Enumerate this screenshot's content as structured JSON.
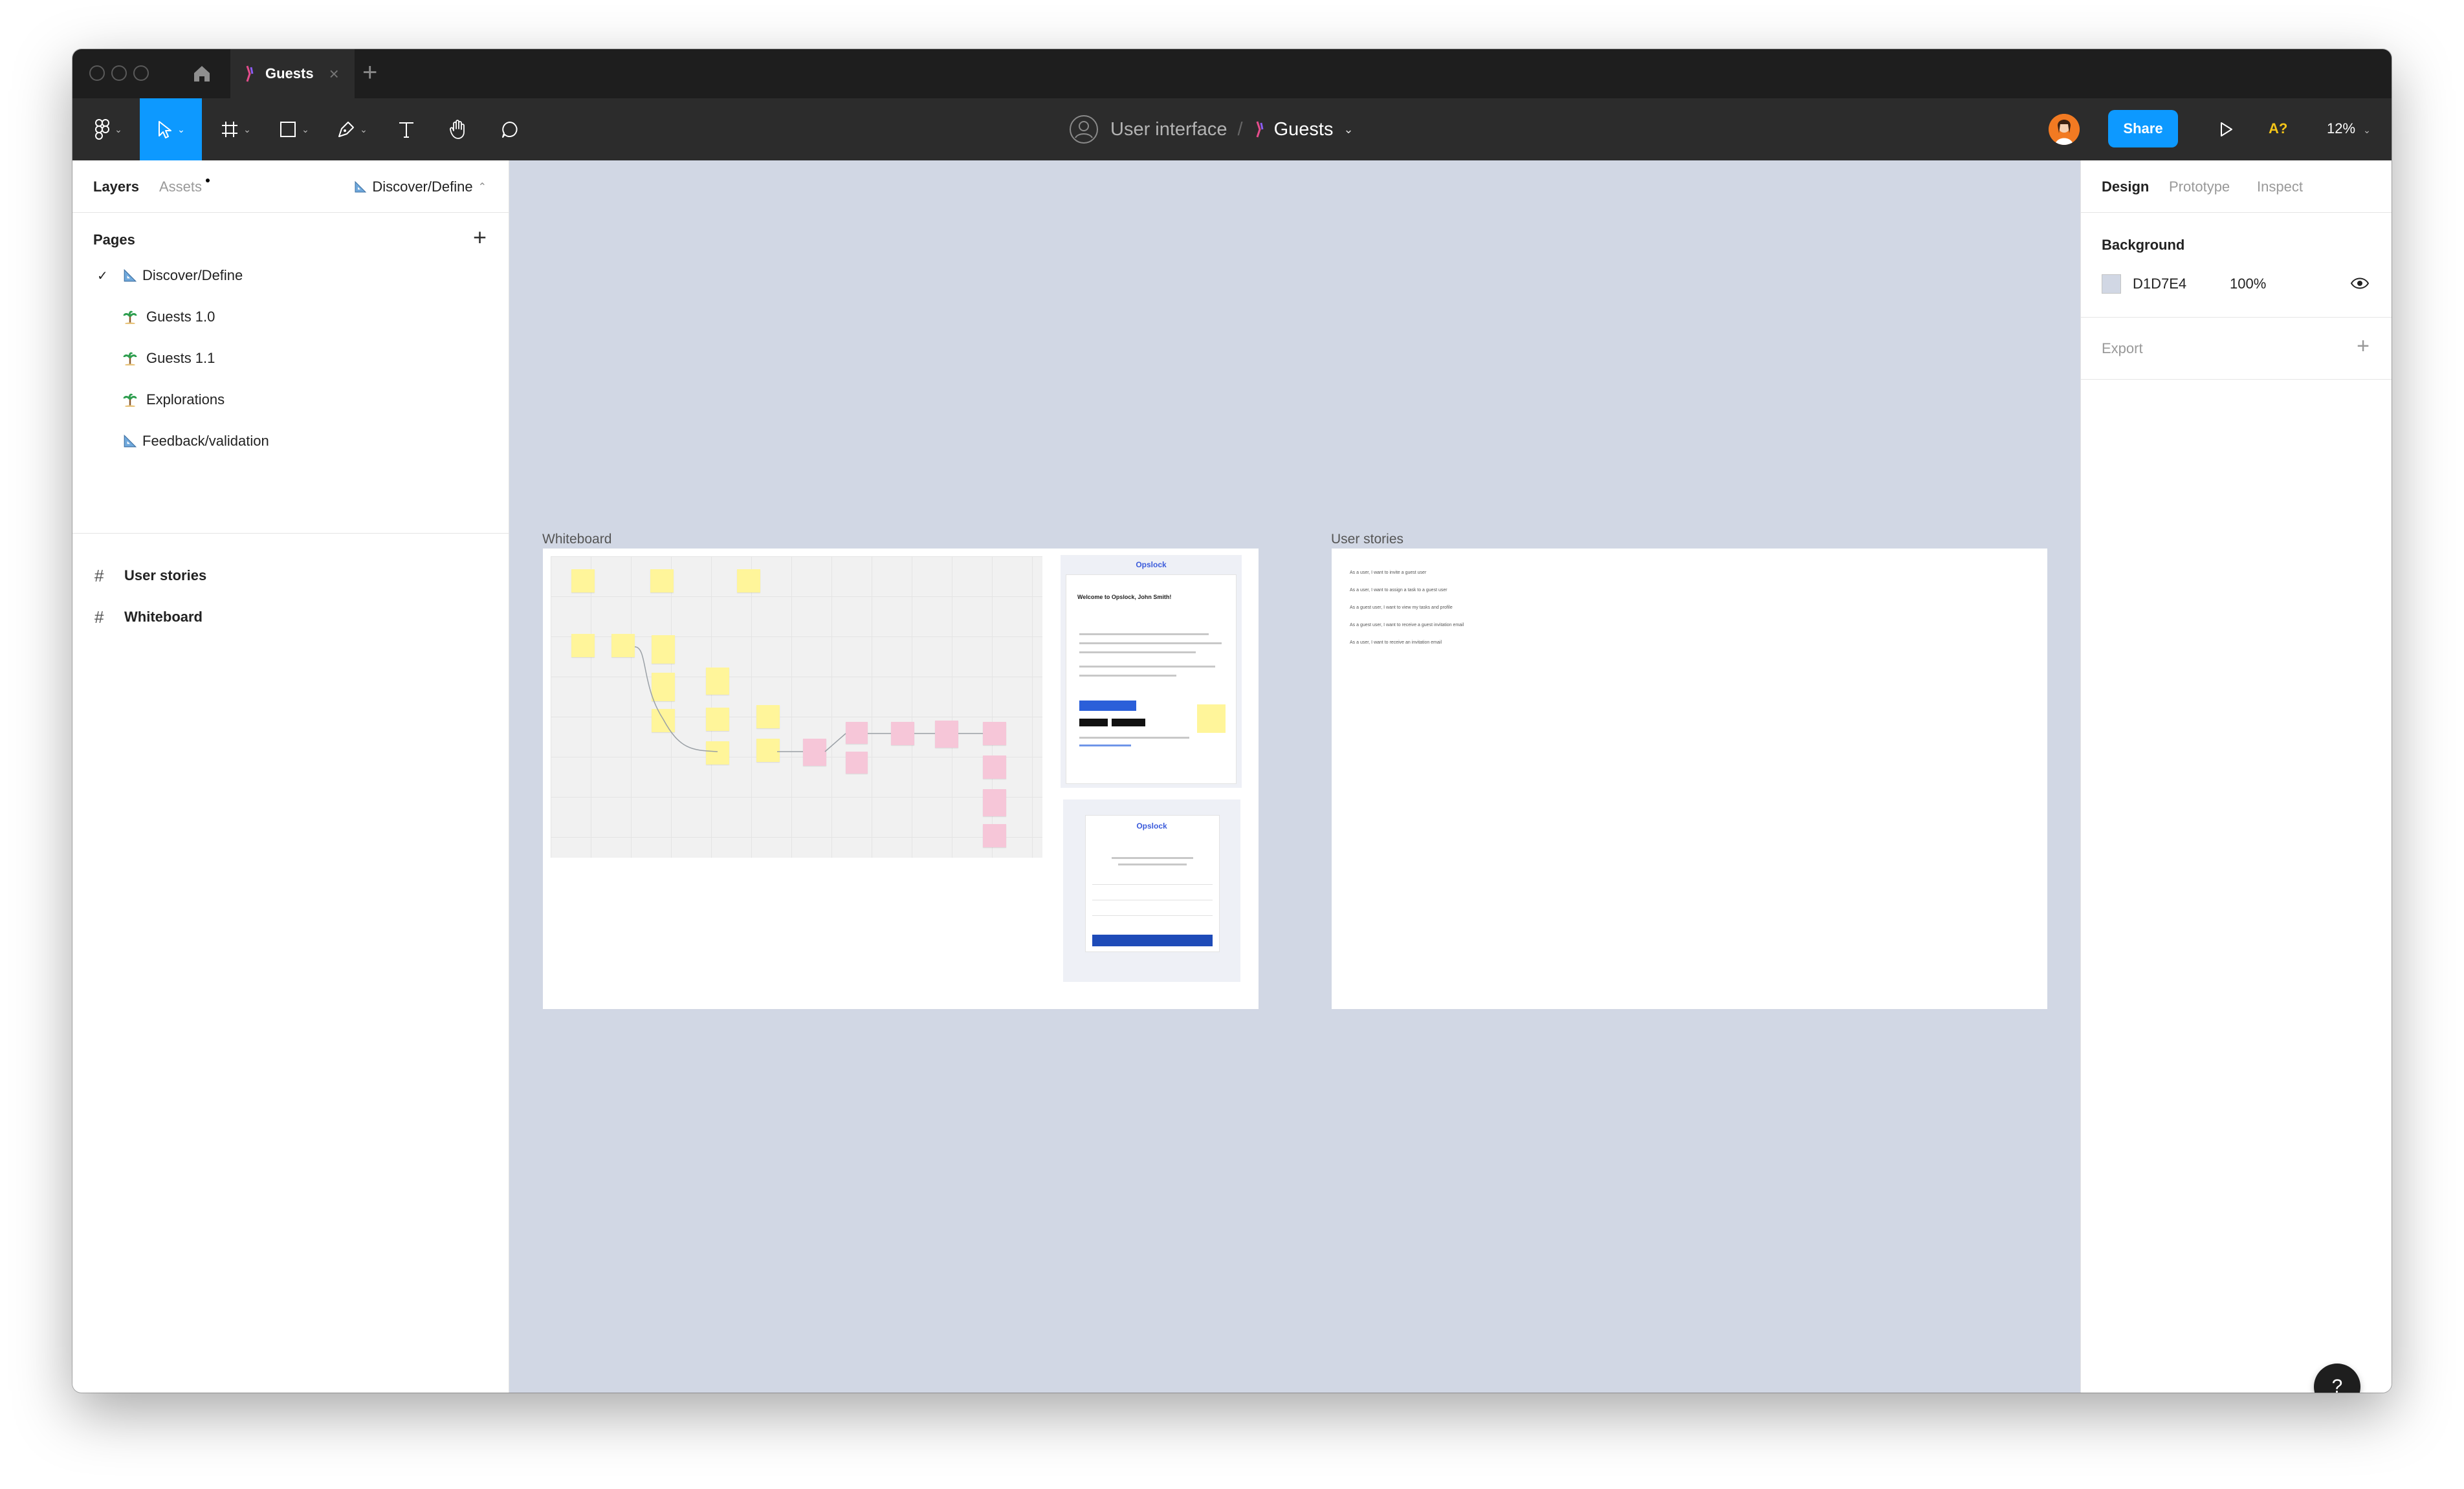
{
  "titlebar": {
    "tab_label": "Guests",
    "tab_close": "×",
    "new_tab": "+"
  },
  "toolbar": {
    "breadcrumb_project": "User interface",
    "breadcrumb_separator": "/",
    "breadcrumb_file": "Guests",
    "share_label": "Share",
    "a11y_label": "A?",
    "zoom_label": "12%",
    "accent": "#0d99ff"
  },
  "left_panel": {
    "tab_layers": "Layers",
    "tab_assets": "Assets",
    "current_page": "Discover/Define",
    "pages_title": "Pages",
    "pages_add": "+",
    "pages": [
      {
        "label": "Discover/Define",
        "icon": "triangle-ruler-icon",
        "selected": true
      },
      {
        "label": "Guests 1.0",
        "icon": "palm-tree-icon",
        "selected": false
      },
      {
        "label": "Guests 1.1",
        "icon": "palm-tree-icon",
        "selected": false
      },
      {
        "label": "Explorations",
        "icon": "palm-tree-icon",
        "selected": false
      },
      {
        "label": "Feedback/validation",
        "icon": "triangle-ruler-icon",
        "selected": false
      }
    ],
    "layers": [
      {
        "label": "User stories",
        "icon": "frame-hash-icon"
      },
      {
        "label": "Whiteboard",
        "icon": "frame-hash-icon"
      }
    ]
  },
  "right_panel": {
    "tab_design": "Design",
    "tab_prototype": "Prototype",
    "tab_inspect": "Inspect",
    "background_title": "Background",
    "background_hex": "D1D7E4",
    "background_opacity": "100%",
    "background_color": "#d1d7e4",
    "export_title": "Export",
    "export_add": "+",
    "help_label": "?"
  },
  "canvas": {
    "whiteboard_label": "Whiteboard",
    "user_stories_label": "User stories",
    "email_brand": "Opslock",
    "email_heading": "Welcome to Opslock, John Smith!",
    "stories": [
      "As a user, I want to invite a guest user",
      "As a user, I want to assign a task to a guest user",
      "As a guest user, I want to view my tasks and profile",
      "As a guest user, I want to receive a guest invitation email",
      "As a user, I want to receive an invitation email"
    ]
  }
}
